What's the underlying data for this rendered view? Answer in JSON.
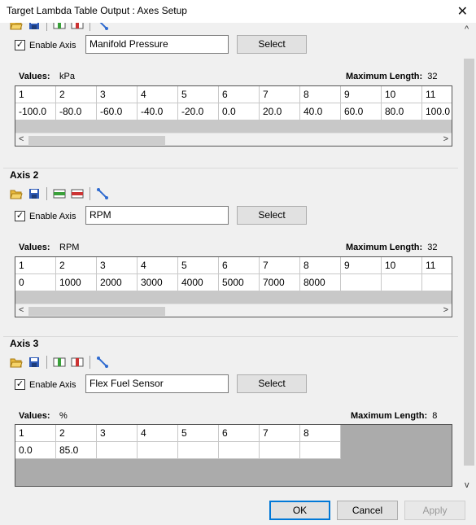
{
  "window": {
    "title": "Target Lambda Table Output : Axes Setup",
    "close_glyph": "✕"
  },
  "enable_label": "Enable Axis",
  "select_label": "Select",
  "values_label": "Values:",
  "maxlen_label": "Maximum Length:",
  "axes": [
    {
      "title": "",
      "enabled": true,
      "source": "Manifold Pressure",
      "unit": "kPa",
      "max_length": "32",
      "headers": [
        "1",
        "2",
        "3",
        "4",
        "5",
        "6",
        "7",
        "8",
        "9",
        "10",
        "11"
      ],
      "values": [
        "-100.0",
        "-80.0",
        "-60.0",
        "-40.0",
        "-20.0",
        "0.0",
        "20.0",
        "40.0",
        "60.0",
        "80.0",
        "100.0"
      ]
    },
    {
      "title": "Axis 2",
      "enabled": true,
      "source": "RPM",
      "unit": "RPM",
      "max_length": "32",
      "headers": [
        "1",
        "2",
        "3",
        "4",
        "5",
        "6",
        "7",
        "8",
        "9",
        "10",
        "11"
      ],
      "values": [
        "0",
        "1000",
        "2000",
        "3000",
        "4000",
        "5000",
        "7000",
        "8000",
        "",
        "",
        ""
      ]
    },
    {
      "title": "Axis 3",
      "enabled": true,
      "source": "Flex Fuel Sensor",
      "unit": "%",
      "max_length": "8",
      "headers": [
        "1",
        "2",
        "3",
        "4",
        "5",
        "6",
        "7",
        "8"
      ],
      "values": [
        "0.0",
        "85.0",
        "",
        "",
        "",
        "",
        "",
        ""
      ]
    }
  ],
  "buttons": {
    "ok": "OK",
    "cancel": "Cancel",
    "apply": "Apply"
  },
  "colors": {
    "accent": "#0078d7",
    "grid_gray": "#c8c8c8",
    "empty_area": "#ababab"
  }
}
